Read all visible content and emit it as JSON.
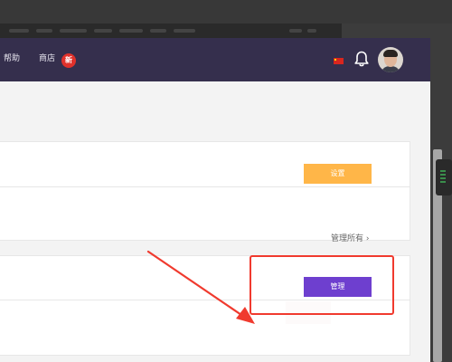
{
  "header": {
    "help_label": "帮助",
    "store_label": "商店",
    "store_badge": "新",
    "icons": [
      "china-flag-icon",
      "bell-icon",
      "user-avatar"
    ]
  },
  "settings_card": {
    "button_label": "设置"
  },
  "manage_card": {
    "manage_all_label": "管理所有 ›",
    "button_label": "管理"
  },
  "colors": {
    "nav_background": "#352f4d",
    "settings_button": "#ffb648",
    "manage_button": "#6e3fcf",
    "annotation": "#f03a2e"
  }
}
